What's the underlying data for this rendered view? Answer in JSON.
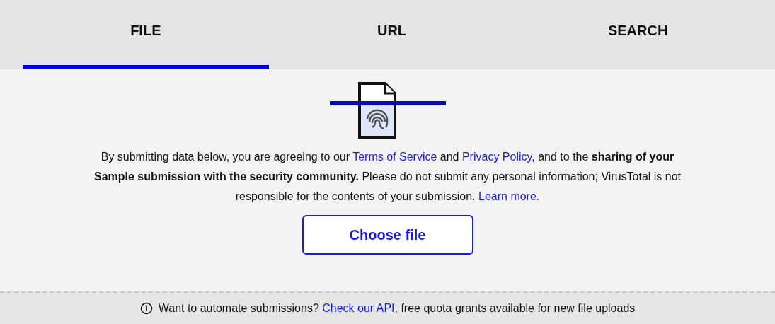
{
  "tabs": [
    {
      "label": "FILE",
      "selected": true
    },
    {
      "label": "URL",
      "selected": false
    },
    {
      "label": "SEARCH",
      "selected": false
    }
  ],
  "notice": {
    "parts": [
      {
        "kind": "text",
        "text": "By submitting data below, you are agreeing to our "
      },
      {
        "kind": "link",
        "text": "Terms of Service"
      },
      {
        "kind": "text",
        "text": " and "
      },
      {
        "kind": "link",
        "text": "Privacy Policy"
      },
      {
        "kind": "text",
        "text": ", and to the "
      },
      {
        "kind": "bold",
        "text": "sharing of your Sample submission with the security community."
      },
      {
        "kind": "text",
        "text": " Please do not submit any personal information; VirusTotal is not responsible for the contents of your submission. "
      },
      {
        "kind": "link",
        "text": "Learn more."
      }
    ]
  },
  "choose_button": "Choose file",
  "footer": {
    "parts": [
      {
        "kind": "text",
        "text": "Want to automate submissions? "
      },
      {
        "kind": "link",
        "text": "Check our API"
      },
      {
        "kind": "text",
        "text": ", free quota grants available for new file uploads"
      }
    ]
  }
}
